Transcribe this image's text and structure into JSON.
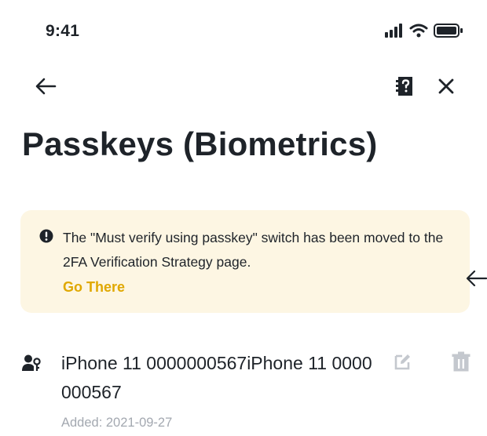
{
  "status_bar": {
    "time": "9:41",
    "icons": [
      "signal-icon",
      "wifi-icon",
      "battery-icon"
    ]
  },
  "nav": {
    "icons": [
      "back-arrow-icon",
      "help-document-icon",
      "close-icon"
    ]
  },
  "page": {
    "title": "Passkeys (Biometrics)"
  },
  "notice": {
    "icon": "exclamation-circle-icon",
    "message": "The \"Must verify using passkey\" switch has been moved to the 2FA Verification Strategy page.",
    "link_label": "Go There",
    "link_color": "#e0a800",
    "background_color": "#fdf6e3"
  },
  "passkeys": [
    {
      "icon": "person-key-icon",
      "name": "iPhone 11 0000000567iPhone 11 0000000567",
      "added": "Added: 2021-09-27",
      "actions": [
        "edit-icon",
        "trash-icon"
      ]
    }
  ],
  "colors": {
    "text_primary": "#1e2329",
    "text_secondary": "#a3a8b0",
    "action_icon": "#c4c8ce"
  }
}
